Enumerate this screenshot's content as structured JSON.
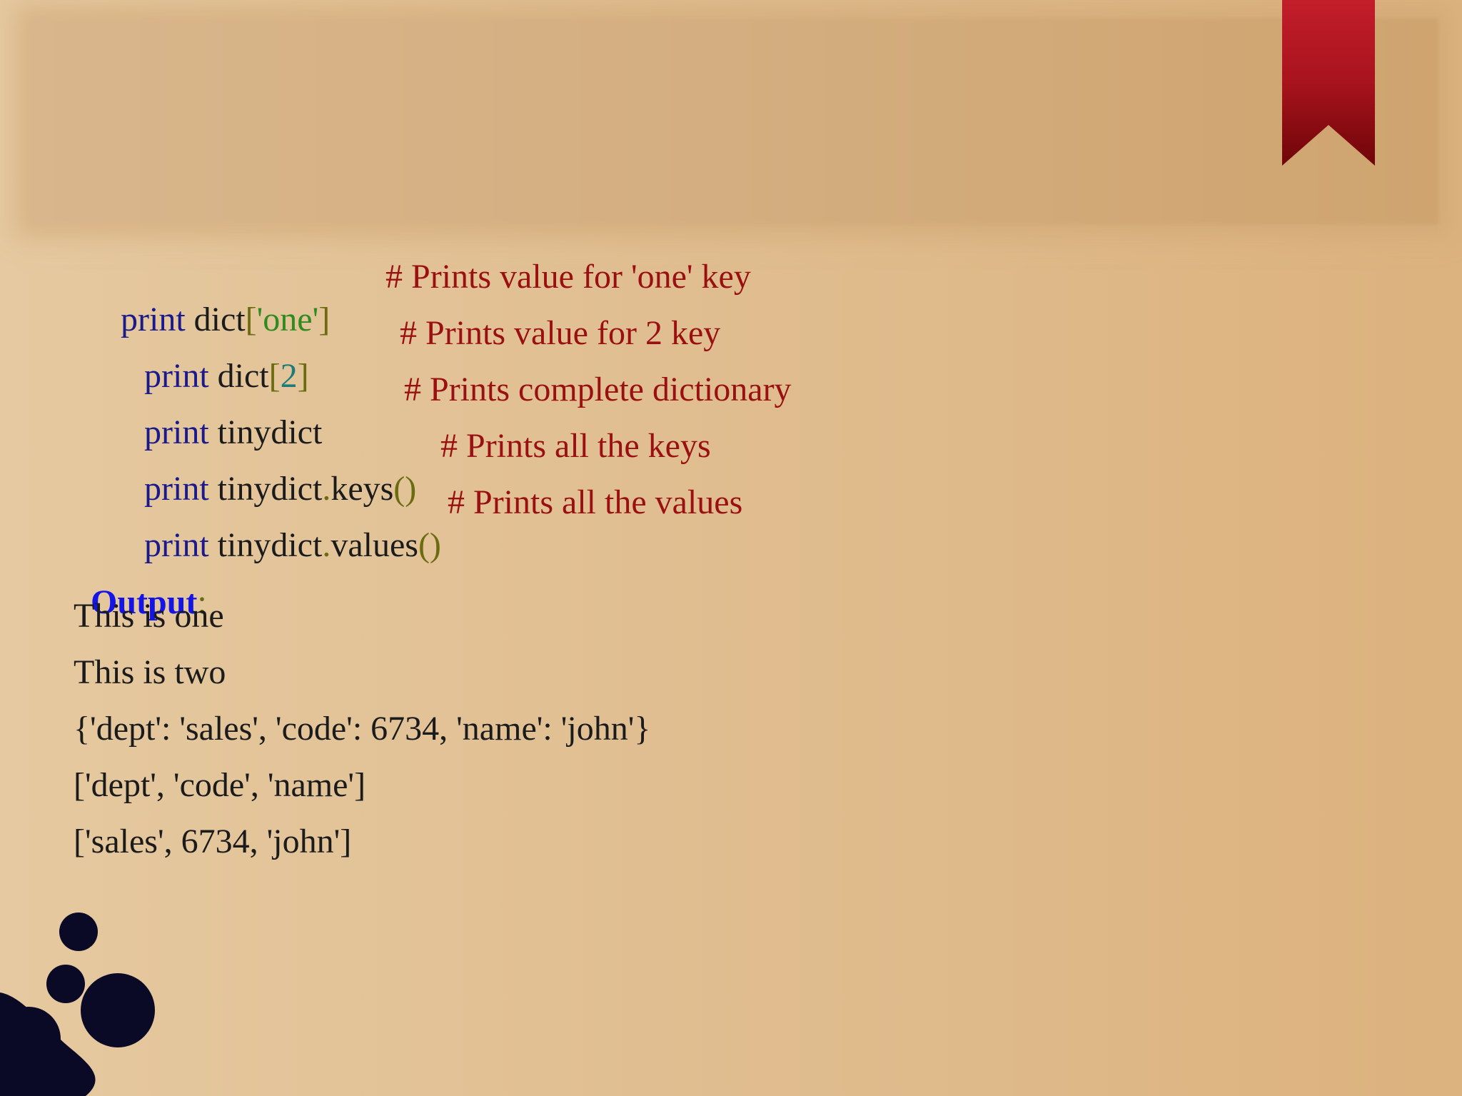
{
  "code": [
    {
      "kw": "print",
      "ident": "dict",
      "open": "[",
      "arg": "'one'",
      "close": "]",
      "comment": "# Prints value for 'one' key"
    },
    {
      "kw": "print",
      "ident": "dict",
      "open": "[",
      "arg": "2",
      "close": "]",
      "comment": "# Prints value for 2 key"
    },
    {
      "kw": "print",
      "ident": "tinydict",
      "comment": "# Prints complete dictionary"
    },
    {
      "kw": "print",
      "ident": "tinydict",
      "dot": ".",
      "method": "keys",
      "parens": "()",
      "comment": "# Prints all the keys"
    },
    {
      "kw": "print",
      "ident": "tinydict",
      "dot": ".",
      "method": "values",
      "parens": "()",
      "comment": "# Prints all the values"
    }
  ],
  "output": {
    "label": "Output",
    "colon": ":",
    "lines": [
      "This is one",
      "This is two",
      "{'dept': 'sales', 'code': 6734, 'name': 'john'}",
      "['dept', 'code', 'name']",
      "['sales', 6734, 'john']"
    ]
  },
  "colors": {
    "keyword": "#1a1a8c",
    "string": "#2f8a1f",
    "comment": "#9a1010",
    "output_label": "#1414e6",
    "bookmark": "#a8131d",
    "ink": "#0a0a26"
  }
}
